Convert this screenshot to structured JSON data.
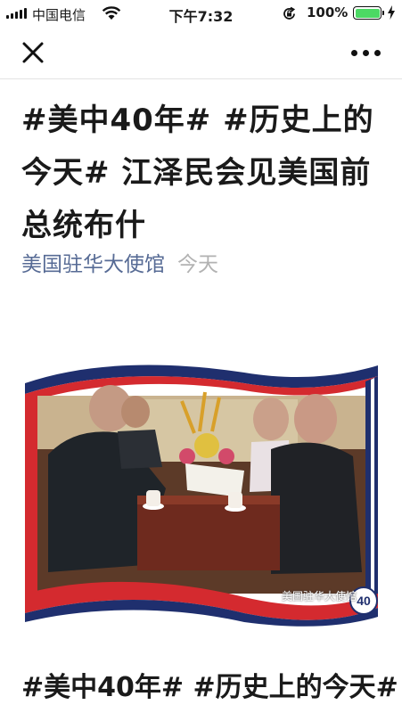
{
  "status_bar": {
    "carrier": "中国电信",
    "time": "下午7:32",
    "battery_percent": "100%"
  },
  "nav": {
    "close_icon": "close-icon",
    "more_icon": "more-icon"
  },
  "article": {
    "title": "#美中40年# #历史上的今天# 江泽民会见美国前总统布什",
    "account_name": "美国驻华大使馆",
    "date": "今天",
    "photo_watermark": "美国驻华大使馆",
    "photo_badge": "40",
    "subheading": "#美中40年# #历史上的今天#"
  },
  "colors": {
    "account_link": "#576b95",
    "date": "#b2b2b2",
    "flag_red": "#d42a2f",
    "flag_blue": "#1f2f6e",
    "battery": "#4cd964"
  }
}
